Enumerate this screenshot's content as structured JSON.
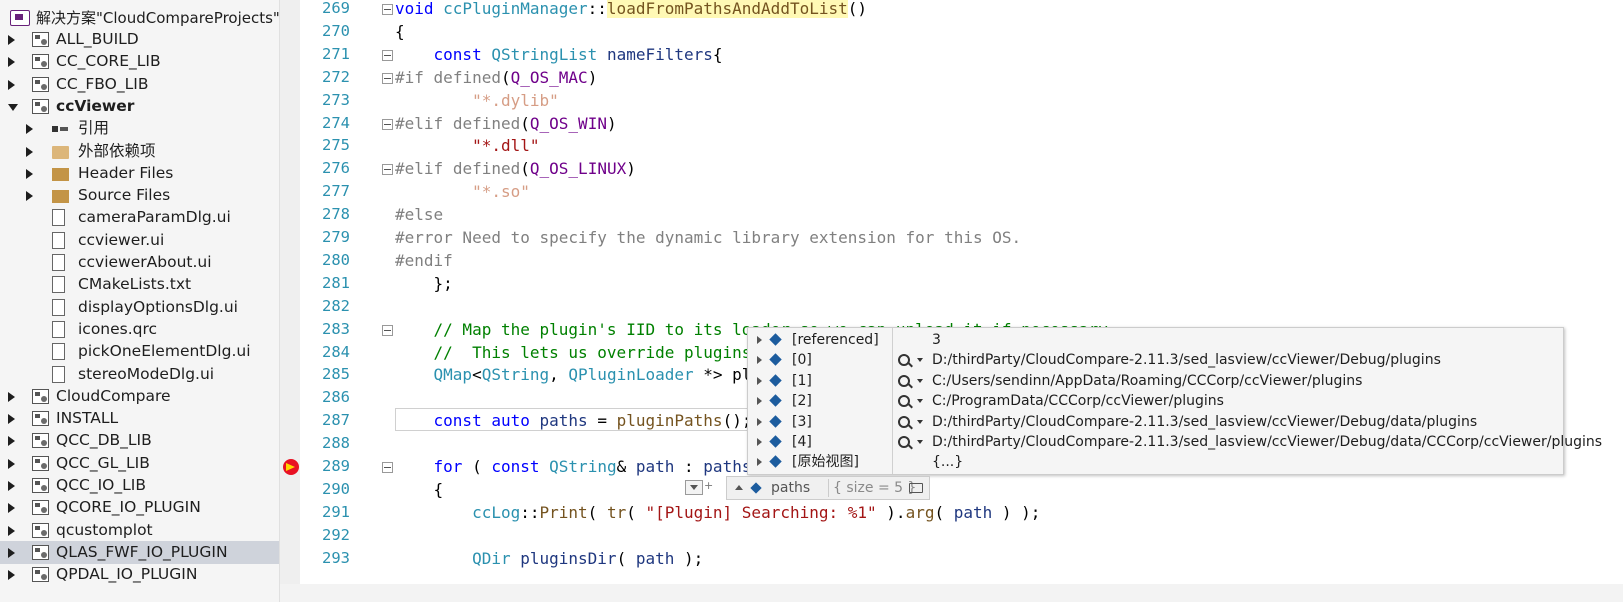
{
  "solution_explorer": {
    "title": "解决方案\"CloudCompareProjects\"(",
    "items": [
      {
        "label": "ALL_BUILD",
        "kind": "project",
        "expander": "collapsed",
        "level": 0
      },
      {
        "label": "CC_CORE_LIB",
        "kind": "project",
        "expander": "collapsed",
        "level": 0
      },
      {
        "label": "CC_FBO_LIB",
        "kind": "project",
        "expander": "collapsed",
        "level": 0
      },
      {
        "label": "ccViewer",
        "kind": "project",
        "expander": "expanded",
        "level": 0,
        "bold": true
      },
      {
        "label": "引用",
        "kind": "references",
        "expander": "collapsed",
        "level": 1
      },
      {
        "label": "外部依赖项",
        "kind": "folder",
        "expander": "collapsed",
        "level": 1
      },
      {
        "label": "Header Files",
        "kind": "filter",
        "expander": "collapsed",
        "level": 1
      },
      {
        "label": "Source Files",
        "kind": "filter",
        "expander": "collapsed",
        "level": 1
      },
      {
        "label": "cameraParamDlg.ui",
        "kind": "file",
        "expander": "none",
        "level": 1
      },
      {
        "label": "ccviewer.ui",
        "kind": "file",
        "expander": "none",
        "level": 1
      },
      {
        "label": "ccviewerAbout.ui",
        "kind": "file",
        "expander": "none",
        "level": 1
      },
      {
        "label": "CMakeLists.txt",
        "kind": "file",
        "expander": "none",
        "level": 1
      },
      {
        "label": "displayOptionsDlg.ui",
        "kind": "file",
        "expander": "none",
        "level": 1
      },
      {
        "label": "icones.qrc",
        "kind": "file",
        "expander": "none",
        "level": 1
      },
      {
        "label": "pickOneElementDlg.ui",
        "kind": "file",
        "expander": "none",
        "level": 1
      },
      {
        "label": "stereoModeDlg.ui",
        "kind": "file",
        "expander": "none",
        "level": 1
      },
      {
        "label": "CloudCompare",
        "kind": "project",
        "expander": "collapsed",
        "level": 0
      },
      {
        "label": "INSTALL",
        "kind": "project",
        "expander": "collapsed",
        "level": 0
      },
      {
        "label": "QCC_DB_LIB",
        "kind": "project",
        "expander": "collapsed",
        "level": 0
      },
      {
        "label": "QCC_GL_LIB",
        "kind": "project",
        "expander": "collapsed",
        "level": 0
      },
      {
        "label": "QCC_IO_LIB",
        "kind": "project",
        "expander": "collapsed",
        "level": 0
      },
      {
        "label": "QCORE_IO_PLUGIN",
        "kind": "project",
        "expander": "collapsed",
        "level": 0
      },
      {
        "label": "qcustomplot",
        "kind": "project",
        "expander": "collapsed",
        "level": 0
      },
      {
        "label": "QLAS_FWF_IO_PLUGIN",
        "kind": "project",
        "expander": "collapsed",
        "level": 0,
        "selected": true
      },
      {
        "label": "QPDAL_IO_PLUGIN",
        "kind": "project",
        "expander": "collapsed",
        "level": 0
      }
    ]
  },
  "editor": {
    "current_execution_line": "289",
    "lines": [
      {
        "num": "269",
        "fold": true,
        "html_key": 0
      },
      {
        "num": "270",
        "html_key": 1
      },
      {
        "num": "271",
        "fold": true,
        "html_key": 2
      },
      {
        "num": "272",
        "fold": true,
        "html_key": 3
      },
      {
        "num": "273",
        "html_key": 4
      },
      {
        "num": "274",
        "fold": true,
        "html_key": 5
      },
      {
        "num": "275",
        "html_key": 6
      },
      {
        "num": "276",
        "fold": true,
        "html_key": 7
      },
      {
        "num": "277",
        "html_key": 8
      },
      {
        "num": "278",
        "html_key": 9
      },
      {
        "num": "279",
        "html_key": 10
      },
      {
        "num": "280",
        "html_key": 11
      },
      {
        "num": "281",
        "html_key": 12
      },
      {
        "num": "282",
        "html_key": 13
      },
      {
        "num": "283",
        "fold": true,
        "html_key": 14
      },
      {
        "num": "284",
        "html_key": 15
      },
      {
        "num": "285",
        "html_key": 16
      },
      {
        "num": "286",
        "html_key": 17
      },
      {
        "num": "287",
        "html_key": 18
      },
      {
        "num": "288",
        "html_key": 19
      },
      {
        "num": "289",
        "fold": true,
        "html_key": 20
      },
      {
        "num": "290",
        "html_key": 21
      },
      {
        "num": "291",
        "html_key": 22
      },
      {
        "num": "292",
        "html_key": 23
      },
      {
        "num": "293",
        "html_key": 24
      }
    ],
    "tokens": [
      [
        [
          "kw",
          "void"
        ],
        [
          "",
          ""
        ],
        [
          "ty",
          " ccPluginManager"
        ],
        [
          "",
          "::"
        ],
        [
          "fn hl",
          "loadFromPathsAndAddToList"
        ],
        [
          "",
          "()"
        ]
      ],
      [
        [
          "",
          "{"
        ]
      ],
      [
        [
          "",
          "    "
        ],
        [
          "kw",
          "const"
        ],
        [
          "",
          " "
        ],
        [
          "ty",
          "QStringList"
        ],
        [
          "",
          " "
        ],
        [
          "var",
          "nameFilters"
        ],
        [
          "",
          "{"
        ]
      ],
      [
        [
          "pp",
          "#if"
        ],
        [
          "",
          " "
        ],
        [
          "pp",
          "defined"
        ],
        [
          "",
          "("
        ],
        [
          "mac",
          "Q_OS_MAC"
        ],
        [
          "",
          ")"
        ]
      ],
      [
        [
          "",
          "        "
        ],
        [
          "str2",
          "\"*.dylib\""
        ]
      ],
      [
        [
          "pp",
          "#elif"
        ],
        [
          "",
          " "
        ],
        [
          "pp",
          "defined"
        ],
        [
          "",
          "("
        ],
        [
          "mac",
          "Q_OS_WIN"
        ],
        [
          "",
          ")"
        ]
      ],
      [
        [
          "",
          "        "
        ],
        [
          "str",
          "\"*.dll\""
        ]
      ],
      [
        [
          "pp",
          "#elif"
        ],
        [
          "",
          " "
        ],
        [
          "pp",
          "defined"
        ],
        [
          "",
          "("
        ],
        [
          "mac",
          "Q_OS_LINUX"
        ],
        [
          "",
          ")"
        ]
      ],
      [
        [
          "",
          "        "
        ],
        [
          "str2",
          "\"*.so\""
        ]
      ],
      [
        [
          "pp",
          "#else"
        ]
      ],
      [
        [
          "pp",
          "#error"
        ],
        [
          "pp",
          " Need to specify the dynamic library extension for this OS."
        ]
      ],
      [
        [
          "pp",
          "#endif"
        ]
      ],
      [
        [
          "",
          "    };"
        ]
      ],
      [
        [
          "",
          ""
        ]
      ],
      [
        [
          "",
          "    "
        ],
        [
          "cm",
          "// Map the plugin's IID to its loader so we can unload it if necessary"
        ]
      ],
      [
        [
          "",
          "    "
        ],
        [
          "cm",
          "//  This lets us override plugins"
        ]
      ],
      [
        [
          "",
          "    "
        ],
        [
          "ty",
          "QMap"
        ],
        [
          "",
          "<"
        ],
        [
          "ty",
          "QString"
        ],
        [
          "",
          ", "
        ],
        [
          "ty",
          "QPluginLoader"
        ],
        [
          "",
          " *> pl"
        ]
      ],
      [
        [
          "",
          ""
        ]
      ],
      [
        [
          "",
          "    "
        ],
        [
          "kw",
          "const"
        ],
        [
          "",
          " "
        ],
        [
          "kw",
          "auto"
        ],
        [
          "",
          " "
        ],
        [
          "var",
          "paths"
        ],
        [
          "",
          " = "
        ],
        [
          "fn",
          "pluginPaths"
        ],
        [
          "",
          "();"
        ]
      ],
      [
        [
          "",
          ""
        ]
      ],
      [
        [
          "",
          "    "
        ],
        [
          "kw",
          "for"
        ],
        [
          "",
          "",
          " "
        ],
        [
          "",
          "( "
        ],
        [
          "kw",
          "const"
        ],
        [
          "",
          " "
        ],
        [
          "ty",
          "QString"
        ],
        [
          "",
          "& "
        ],
        [
          "var",
          "path"
        ],
        [
          "",
          " : "
        ],
        [
          "var",
          "paths"
        ]
      ],
      [
        [
          "",
          "    {"
        ]
      ],
      [
        [
          "",
          "        "
        ],
        [
          "ty",
          "ccLog"
        ],
        [
          "",
          "::"
        ],
        [
          "fn",
          "Print"
        ],
        [
          "",
          "( "
        ],
        [
          "fn",
          "tr"
        ],
        [
          "",
          "( "
        ],
        [
          "str",
          "\"[Plugin] Searching: %1\""
        ],
        [
          "",
          " )."
        ],
        [
          "fn",
          "arg"
        ],
        [
          "",
          "( "
        ],
        [
          "var",
          "path"
        ],
        [
          "",
          " ) );"
        ]
      ],
      [
        [
          "",
          ""
        ]
      ],
      [
        [
          "",
          "        "
        ],
        [
          "ty",
          "QDir"
        ],
        [
          "",
          " "
        ],
        [
          "var",
          "pluginsDir"
        ],
        [
          "",
          "( "
        ],
        [
          "var",
          "path"
        ],
        [
          "",
          " );"
        ]
      ]
    ]
  },
  "datatip": {
    "rows": [
      {
        "name": "[referenced]",
        "value": "3",
        "has_search": false
      },
      {
        "name": "[0]",
        "value": "D:/thirdParty/CloudCompare-2.11.3/sed_lasview/ccViewer/Debug/plugins",
        "has_search": true
      },
      {
        "name": "[1]",
        "value": "C:/Users/sendinn/AppData/Roaming/CCCorp/ccViewer/plugins",
        "has_search": true
      },
      {
        "name": "[2]",
        "value": "C:/ProgramData/CCCorp/ccViewer/plugins",
        "has_search": true
      },
      {
        "name": "[3]",
        "value": "D:/thirdParty/CloudCompare-2.11.3/sed_lasview/ccViewer/Debug/data/plugins",
        "has_search": true
      },
      {
        "name": "[4]",
        "value": "D:/thirdParty/CloudCompare-2.11.3/sed_lasview/ccViewer/Debug/data/CCCorp/ccViewer/plugins",
        "has_search": true
      },
      {
        "name": "[原始视图]",
        "value": "{...}",
        "has_search": false
      }
    ],
    "bar": {
      "name": "paths",
      "size": "{ size = 5 }"
    }
  },
  "colors": {
    "keyword": "#0000ff",
    "type": "#2b91af",
    "comment": "#008000",
    "string": "#a31515",
    "macro": "#6f008a",
    "preprocessor": "#808080",
    "selected_row": "#cfd3db"
  }
}
